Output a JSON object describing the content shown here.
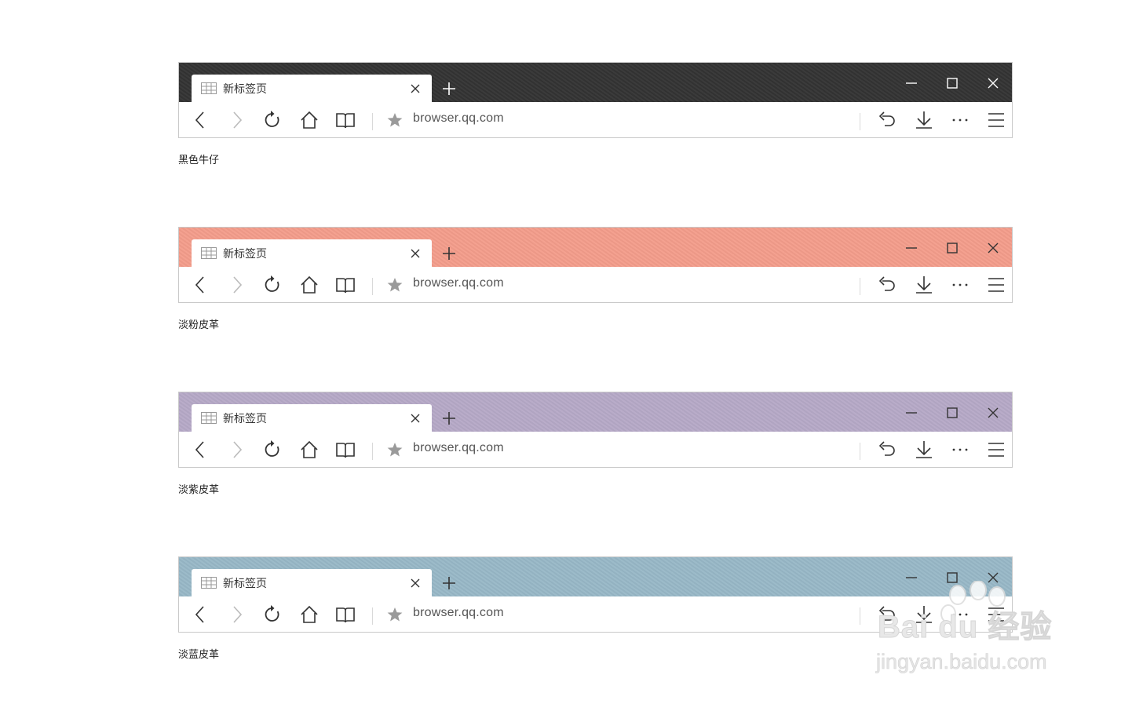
{
  "skins": [
    {
      "caption": "黑色牛仔",
      "titlebar_color": "#333333",
      "icon_color": "#ffffff",
      "tab_title": "新标签页",
      "url": "browser.qq.com"
    },
    {
      "caption": "淡粉皮革",
      "titlebar_color": "#f49d8b",
      "icon_color": "#333333",
      "tab_title": "新标签页",
      "url": "browser.qq.com"
    },
    {
      "caption": "淡紫皮革",
      "titlebar_color": "#b6a9c7",
      "icon_color": "#333333",
      "tab_title": "新标签页",
      "url": "browser.qq.com"
    },
    {
      "caption": "淡蓝皮革",
      "titlebar_color": "#98b8c7",
      "icon_color": "#333333",
      "tab_title": "新标签页",
      "url": "browser.qq.com"
    }
  ],
  "icons": {
    "tab": "grid-icon",
    "tab_close": "close-icon",
    "new_tab": "plus-icon",
    "minimize": "minimize-icon",
    "maximize": "maximize-icon",
    "close": "close-icon",
    "back": "chevron-left-icon",
    "forward": "chevron-right-icon",
    "refresh": "refresh-icon",
    "home": "home-icon",
    "reader": "book-icon",
    "bookmark": "star-icon",
    "undo": "undo-icon",
    "download": "download-icon",
    "more": "ellipsis-icon",
    "menu": "hamburger-icon"
  },
  "watermark": {
    "line1": "Bai du 经验",
    "line2": "jingyan.baidu.com"
  }
}
